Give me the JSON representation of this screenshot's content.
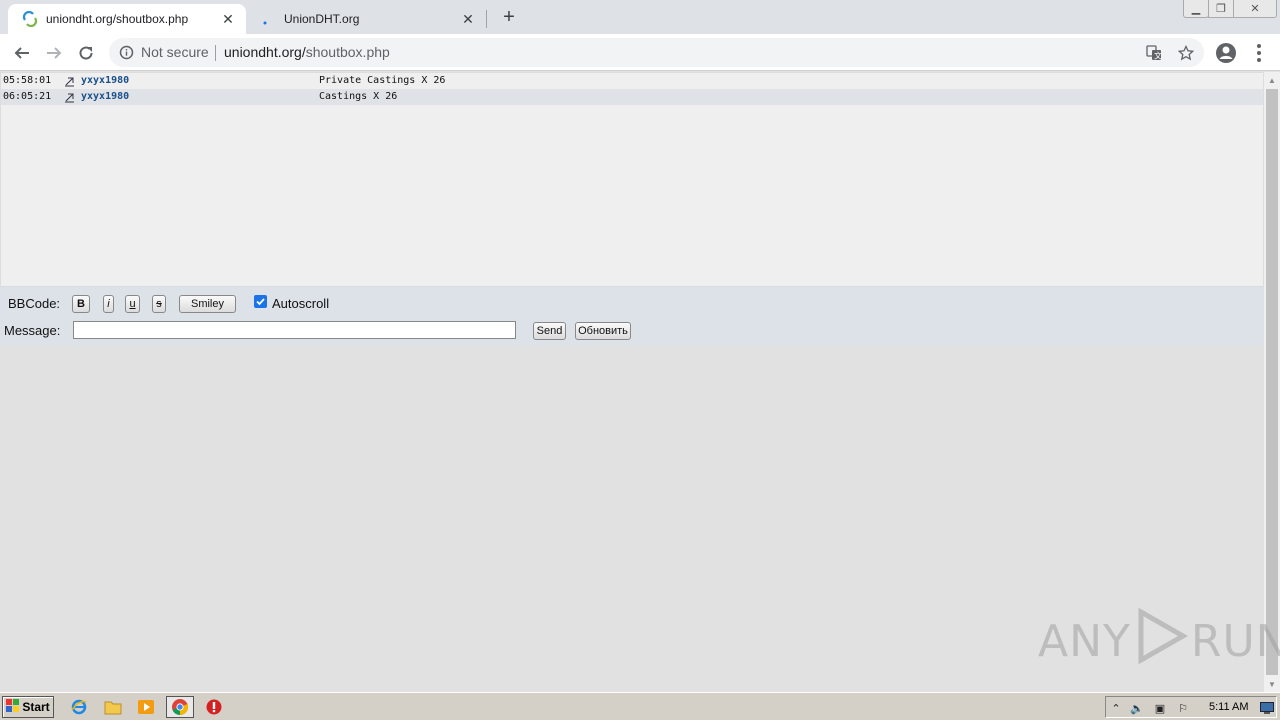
{
  "browser": {
    "tabs": [
      {
        "title": "uniondht.org/shoutbox.php",
        "active": true
      },
      {
        "title": "UnionDHT.org",
        "active": false
      }
    ],
    "security_label": "Not secure",
    "url_host": "uniondht.org/",
    "url_path": "shoutbox.php"
  },
  "shoutbox": {
    "messages": [
      {
        "time": "05:58:01",
        "user": "yxyx1980",
        "text": "Private Castings X 26"
      },
      {
        "time": "06:05:21",
        "user": "yxyx1980",
        "text": "Castings X 26"
      }
    ]
  },
  "controls": {
    "bbcode_label": "BBCode:",
    "bold_label": "B",
    "italic_label": "i",
    "underline_label": "u",
    "strike_label": "s",
    "smiley_label": "Smiley",
    "autoscroll_label": "Autoscroll",
    "autoscroll_checked": true,
    "message_label": "Message:",
    "message_value": "",
    "send_label": "Send",
    "refresh_label": "Обновить"
  },
  "watermark": {
    "left": "ANY",
    "right": "RUN"
  },
  "taskbar": {
    "start_label": "Start",
    "clock": "5:11 AM"
  },
  "colors": {
    "link_user": "#1a4f8a",
    "checkbox": "#1a73e8",
    "row_alt": "#dfe3e8"
  }
}
